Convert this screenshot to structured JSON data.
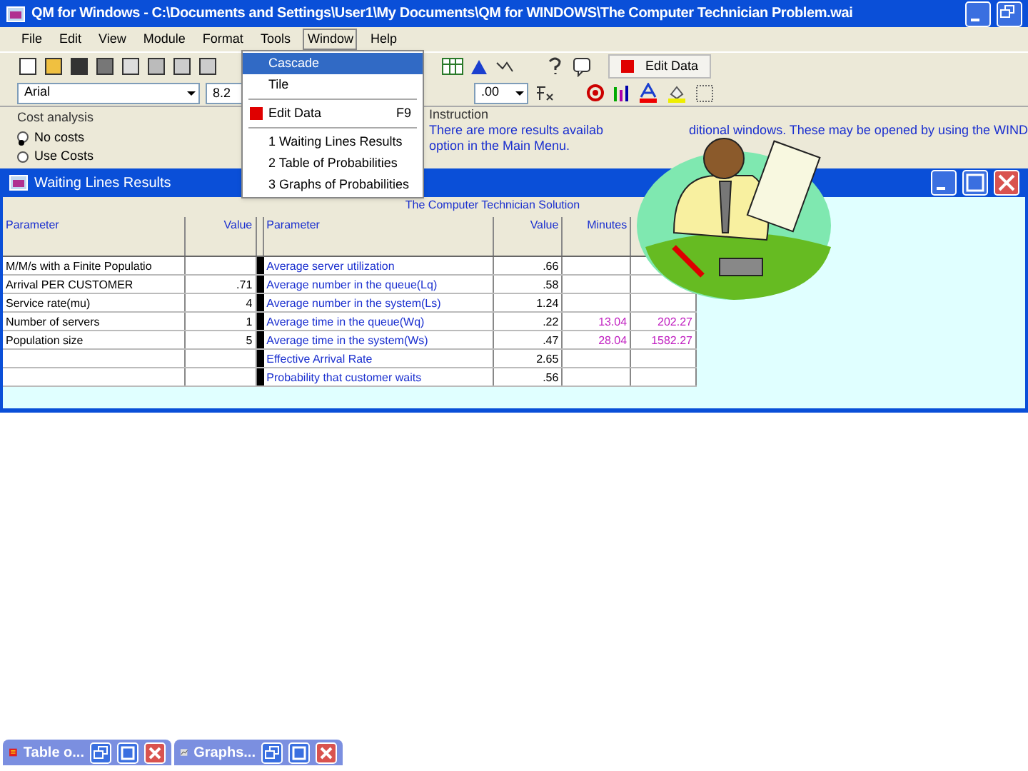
{
  "window": {
    "title": "QM for Windows - C:\\Documents and Settings\\User1\\My Documents\\QM for WINDOWS\\The Computer Technician Problem.wai"
  },
  "menu_bar": [
    {
      "label": "File",
      "selected": false
    },
    {
      "label": "Edit",
      "selected": false
    },
    {
      "label": "View",
      "selected": false
    },
    {
      "label": "Module",
      "selected": false
    },
    {
      "label": "Format",
      "selected": false
    },
    {
      "label": "Tools",
      "selected": false
    },
    {
      "label": "Window",
      "selected": true
    },
    {
      "label": "Help",
      "selected": false
    }
  ],
  "window_menu": [
    {
      "kind": "item",
      "label": "Cascade",
      "selected": true
    },
    {
      "kind": "item",
      "label": "Tile",
      "selected": false
    },
    {
      "kind": "separator"
    },
    {
      "kind": "icon_item",
      "label": "Edit Data",
      "shortcut": "F9",
      "selected": false
    },
    {
      "kind": "separator"
    },
    {
      "kind": "item",
      "label": "1 Waiting Lines Results",
      "selected": false
    },
    {
      "kind": "item",
      "label": "2 Table of Probabilities",
      "selected": false
    },
    {
      "kind": "item",
      "label": "3 Graphs of Probabilities",
      "selected": false
    }
  ],
  "toolbar": {
    "edit_data_button": "Edit Data",
    "font": "Arial",
    "font_size": "8.2",
    "zoom": ".00"
  },
  "cost_analysis": {
    "label": "Cost analysis",
    "options": [
      {
        "label": "No costs",
        "selected": true
      },
      {
        "label": "Use Costs",
        "selected": false
      }
    ]
  },
  "instruction": {
    "label": "Instruction",
    "line_1_parts": [
      "There are more results availab",
      "ditional windows. These may be opened by using the WIND"
    ],
    "line_2": "option in the Main Menu."
  },
  "results_window": {
    "title": "Waiting Lines Results",
    "table_title": "The Computer Technician Solution",
    "columns": [
      "Parameter",
      "Value",
      "Parameter",
      "Value",
      "Minutes"
    ],
    "rows": [
      [
        "M/M/s with a Finite Populatio",
        "",
        "Average server utilization",
        ".66",
        "",
        ""
      ],
      [
        "Arrival PER CUSTOMER",
        ".71",
        "Average number in the queue(Lq)",
        ".58",
        "",
        ""
      ],
      [
        "Service rate(mu)",
        "4",
        "Average number in the system(Ls)",
        "1.24",
        "",
        ""
      ],
      [
        "Number of servers",
        "1",
        "Average time in the queue(Wq)",
        ".22",
        "13.04",
        "202.27"
      ],
      [
        "Population size",
        "5",
        "Average time in the system(Ws)",
        ".47",
        "28.04",
        "1582.27"
      ],
      [
        "",
        "",
        "Effective Arrival Rate",
        "2.65",
        "",
        ""
      ],
      [
        "",
        "",
        "Probability that customer waits",
        ".56",
        "",
        ""
      ]
    ]
  },
  "minimized_windows": [
    {
      "title": "Table o..."
    },
    {
      "title": "Graphs..."
    }
  ]
}
